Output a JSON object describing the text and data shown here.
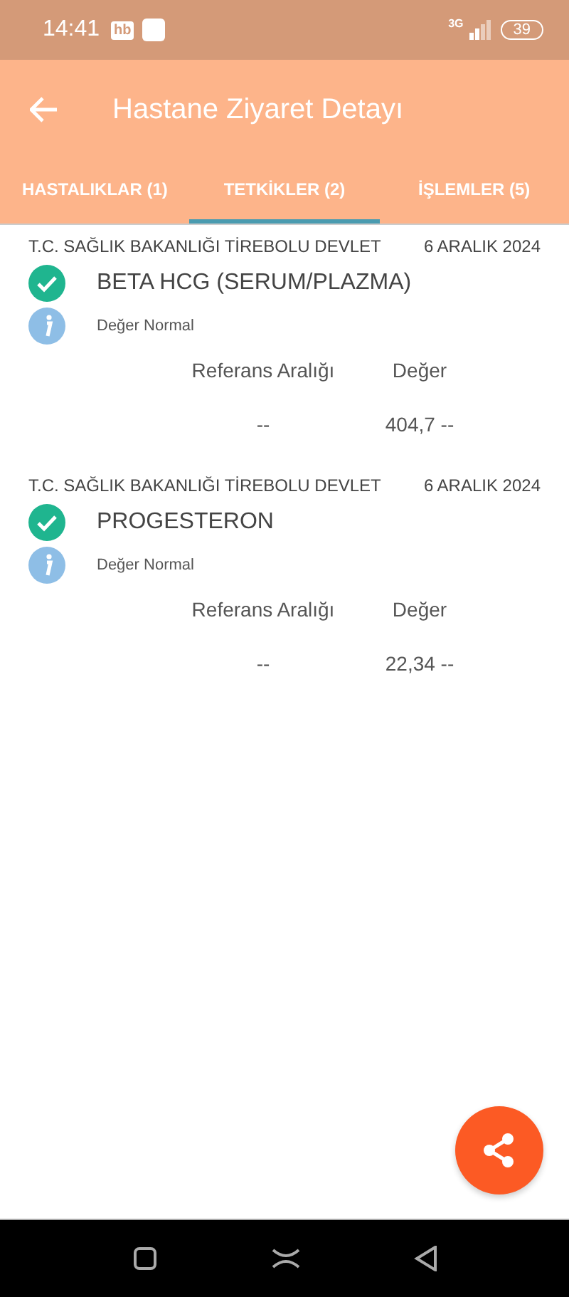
{
  "status_bar": {
    "time": "14:41",
    "app_badge": "hb",
    "network": "3G",
    "battery": "39"
  },
  "app_bar": {
    "title": "Hastane Ziyaret Detayı"
  },
  "tabs": [
    {
      "label": "HASTALIKLAR (1)",
      "selected": false
    },
    {
      "label": "TETKİKLER (2)",
      "selected": true
    },
    {
      "label": "İŞLEMLER (5)",
      "selected": false
    }
  ],
  "results": [
    {
      "hospital": "T.C. SAĞLIK BAKANLIĞI TİREBOLU DEVLET",
      "date": "6 ARALIK 2024",
      "test": "BETA HCG (SERUM/PLAZMA)",
      "note": "Değer Normal",
      "columns": [
        "Referans Aralığı",
        "Değer"
      ],
      "reference": "--",
      "value": "404,7 --"
    },
    {
      "hospital": "T.C. SAĞLIK BAKANLIĞI TİREBOLU DEVLET",
      "date": "6 ARALIK 2024",
      "test": "PROGESTERON",
      "note": "Değer Normal",
      "columns": [
        "Referans Aralığı",
        "Değer"
      ],
      "reference": "--",
      "value": "22,34 --"
    }
  ]
}
